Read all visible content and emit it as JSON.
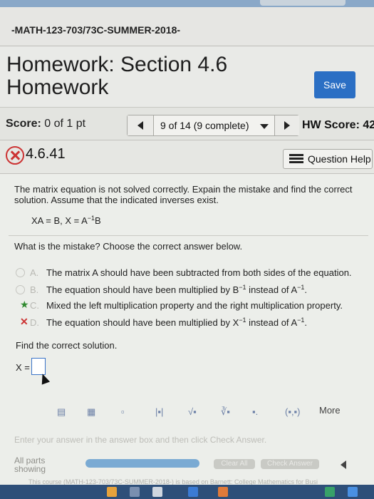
{
  "course_title": "-MATH-123-703/73C-SUMMER-2018-",
  "hw_title": "Homework: Section 4.6 Homework",
  "save_label": "Save",
  "score": {
    "label": "Score:",
    "value": "0 of 1 pt"
  },
  "nav": {
    "position": "9 of 14 (9 complete)"
  },
  "hw_score": "HW Score: 42",
  "question": {
    "id": "4.6.41",
    "help_label": "Question Help",
    "prompt": "The matrix equation is not solved correctly. Expain the mistake and find the correct solution. Assume that the indicated inverses exist.",
    "equation_main": "XA = B, X = A",
    "equation_sup": "−1",
    "equation_tail": "B",
    "instruction": "What is the mistake? Choose the correct answer below.",
    "options": [
      {
        "letter": "A.",
        "text": "The matrix A should have been subtracted from both sides of the equation."
      },
      {
        "letter": "B.",
        "text_a": "The equation should have been multiplied by B",
        "sup_a": "−1",
        "text_b": " instead of A",
        "sup_b": "−1",
        "text_c": "."
      },
      {
        "letter": "C.",
        "text": "Mixed the left multiplication property and the right multiplication property."
      },
      {
        "letter": "D.",
        "text_a": "The equation should have been multiplied by X",
        "sup_a": "−1",
        "text_b": " instead of A",
        "sup_b": "−1",
        "text_c": "."
      }
    ],
    "find_label": "Find the correct solution.",
    "answer_label": "X ="
  },
  "toolbar": {
    "more_label": "More"
  },
  "footer": {
    "instruction": "Enter your answer in the answer box and then click Check Answer.",
    "all_parts_1": "All parts",
    "all_parts_2": "showing",
    "clear_all": "Clear All",
    "check_answer": "Check Answer",
    "note": "This course (MATH-123-703/73C-SUMMER-2018-) is based on Barnett: College Mathematics for Busi"
  },
  "colors": {
    "accent": "#2b6fc4",
    "wrong": "#cc3333",
    "correct": "#2f8a2f"
  }
}
